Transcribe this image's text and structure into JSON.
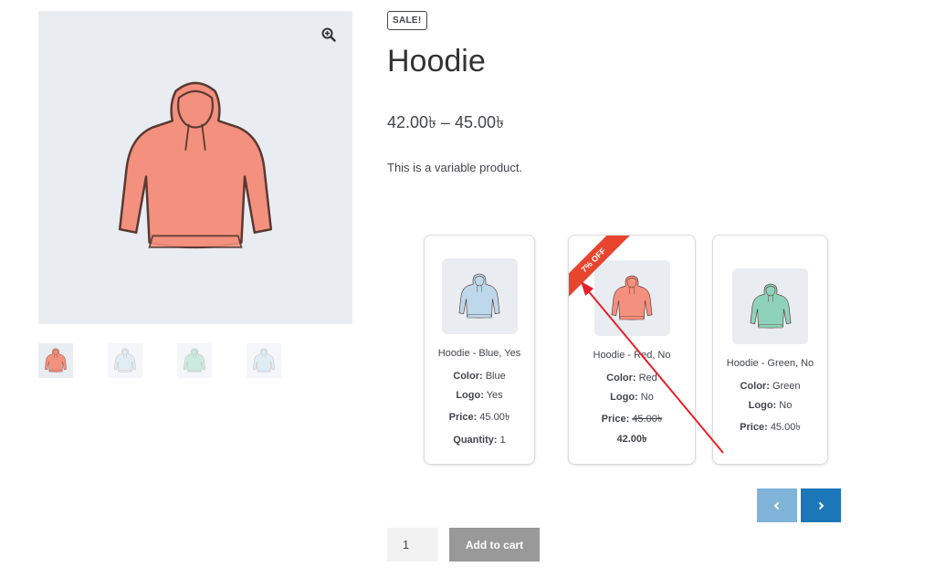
{
  "product": {
    "sale_badge": "SALE!",
    "title": "Hoodie",
    "price_range": "42.00৳ – 45.00৳",
    "description": "This is a variable product."
  },
  "gallery": {
    "zoom_icon": "zoom-in-icon",
    "thumbnails": [
      "hoodie-red",
      "hoodie-blue",
      "hoodie-green",
      "hoodie-blue-logo"
    ]
  },
  "variations": [
    {
      "name": "Hoodie - Blue, Yes",
      "color_label": "Color:",
      "color": "Blue",
      "logo_label": "Logo:",
      "logo": "Yes",
      "price_label": "Price:",
      "price": "45.00৳",
      "quantity_label": "Quantity:",
      "quantity": "1"
    },
    {
      "badge": "7% OFF",
      "name": "Hoodie - Red, No",
      "color_label": "Color:",
      "color": "Red",
      "logo_label": "Logo:",
      "logo": "No",
      "price_label": "Price:",
      "regular_price": "45.00৳",
      "sale_price": "42.00৳"
    },
    {
      "name": "Hoodie - Green, No",
      "color_label": "Color:",
      "color": "Green",
      "logo_label": "Logo:",
      "logo": "No",
      "price_label": "Price:",
      "price": "45.00৳"
    }
  ],
  "carousel": {
    "prev_icon": "chevron-left-icon",
    "next_icon": "chevron-right-icon"
  },
  "cart": {
    "quantity_value": "1",
    "add_label": "Add to cart"
  },
  "colors": {
    "red_hoodie": "#f4907e",
    "blue_hoodie": "#bcd8ea",
    "green_hoodie": "#8fd2bb",
    "badge": "#e8452f",
    "nav_prev": "#7fb4d8",
    "nav_next": "#1b77b8",
    "button": "#999999",
    "annotation_arrow": "#e8202a"
  }
}
